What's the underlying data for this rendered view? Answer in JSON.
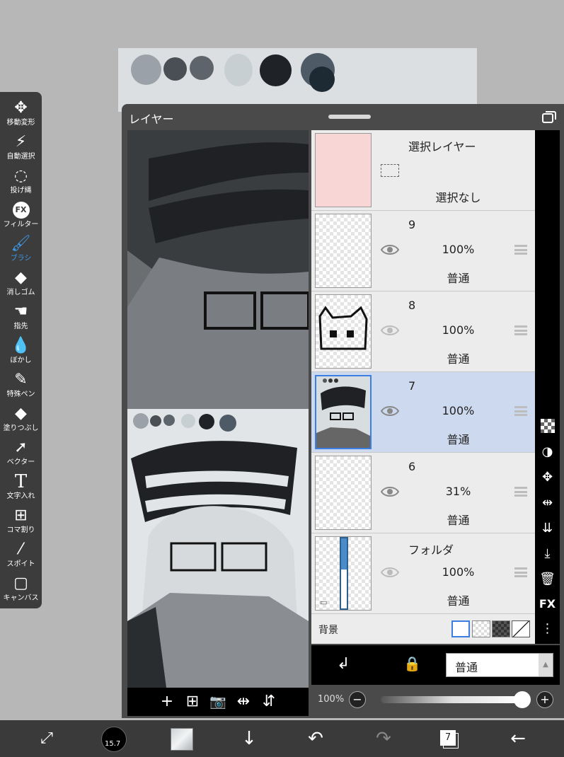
{
  "panel": {
    "title": "レイヤー"
  },
  "toolbar": {
    "items": [
      {
        "label": "移動変形",
        "icon": "move-arrows-icon"
      },
      {
        "label": "自動選択",
        "icon": "magic-wand-icon"
      },
      {
        "label": "投げ縄",
        "icon": "lasso-icon"
      },
      {
        "label": "フィルター",
        "icon": "fx-icon"
      },
      {
        "label": "ブラシ",
        "icon": "brush-icon",
        "active": true
      },
      {
        "label": "消しゴム",
        "icon": "eraser-icon"
      },
      {
        "label": "指先",
        "icon": "smudge-icon"
      },
      {
        "label": "ぼかし",
        "icon": "blur-drop-icon"
      },
      {
        "label": "特殊ペン",
        "icon": "special-pen-icon"
      },
      {
        "label": "塗りつぶし",
        "icon": "fill-bucket-icon"
      },
      {
        "label": "ベクター",
        "icon": "vector-cursor-icon"
      },
      {
        "label": "文字入れ",
        "icon": "text-icon"
      },
      {
        "label": "コマ割り",
        "icon": "frame-divider-icon"
      },
      {
        "label": "スポイト",
        "icon": "eyedropper-icon"
      },
      {
        "label": "キャンバス",
        "icon": "canvas-icon"
      }
    ]
  },
  "layers": {
    "selection": {
      "name": "選択レイヤー",
      "status": "選択なし"
    },
    "rows": [
      {
        "name": "9",
        "opacity": "100%",
        "blend": "普通"
      },
      {
        "name": "8",
        "opacity": "100%",
        "blend": "普通"
      },
      {
        "name": "7",
        "opacity": "100%",
        "blend": "普通",
        "selected": true
      },
      {
        "name": "6",
        "opacity": "31%",
        "blend": "普通"
      },
      {
        "name": "フォルダ",
        "opacity": "100%",
        "blend": "普通",
        "folder": true
      }
    ],
    "background_label": "背景"
  },
  "blend_controls": {
    "mode": "普通",
    "opacity": "100%",
    "opacity_value": 1.0
  },
  "bottom": {
    "brush_size": "15.7",
    "layer_count": "7"
  },
  "colors": {
    "accent": "#3d9ae8",
    "selected_row": "#cdd9ee",
    "selection_thumb": "#f9d6d6"
  }
}
